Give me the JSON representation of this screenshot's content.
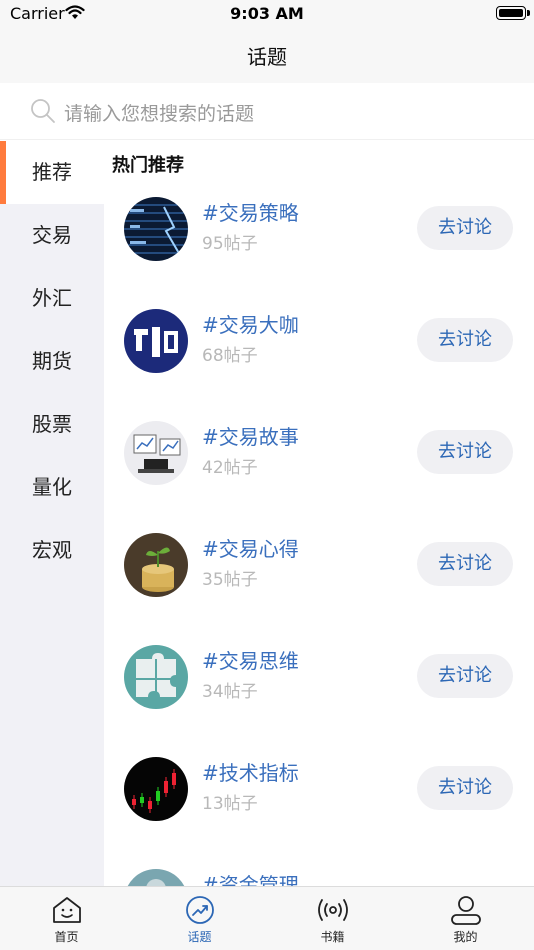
{
  "status_bar": {
    "carrier": "Carrier",
    "time": "9:03 AM"
  },
  "nav": {
    "title": "话题"
  },
  "search": {
    "placeholder": "请输入您想搜索的话题"
  },
  "sidebar": {
    "items": [
      {
        "label": "推荐",
        "active": true
      },
      {
        "label": "交易",
        "active": false
      },
      {
        "label": "外汇",
        "active": false
      },
      {
        "label": "期货",
        "active": false
      },
      {
        "label": "股票",
        "active": false
      },
      {
        "label": "量化",
        "active": false
      },
      {
        "label": "宏观",
        "active": false
      }
    ]
  },
  "content": {
    "section_title": "热门推荐",
    "topics": [
      {
        "name": "#交易策略",
        "count": "95帖子",
        "button": "去讨论"
      },
      {
        "name": "#交易大咖",
        "count": "68帖子",
        "button": "去讨论"
      },
      {
        "name": "#交易故事",
        "count": "42帖子",
        "button": "去讨论"
      },
      {
        "name": "#交易心得",
        "count": "35帖子",
        "button": "去讨论"
      },
      {
        "name": "#交易思维",
        "count": "34帖子",
        "button": "去讨论"
      },
      {
        "name": "#技术指标",
        "count": "13帖子",
        "button": "去讨论"
      },
      {
        "name": "#资金管理",
        "count": "",
        "button": ""
      }
    ]
  },
  "tab_bar": {
    "tabs": [
      {
        "label": "首页",
        "icon": "home-face-icon"
      },
      {
        "label": "话题",
        "icon": "trend-icon",
        "active": true
      },
      {
        "label": "书籍",
        "icon": "broadcast-icon"
      },
      {
        "label": "我的",
        "icon": "person-icon"
      }
    ]
  },
  "colors": {
    "accent": "#ff7b3d",
    "link": "#3a6fbd",
    "tab_active": "#2c67b5",
    "sidebar_bg": "#f1f1f6"
  }
}
